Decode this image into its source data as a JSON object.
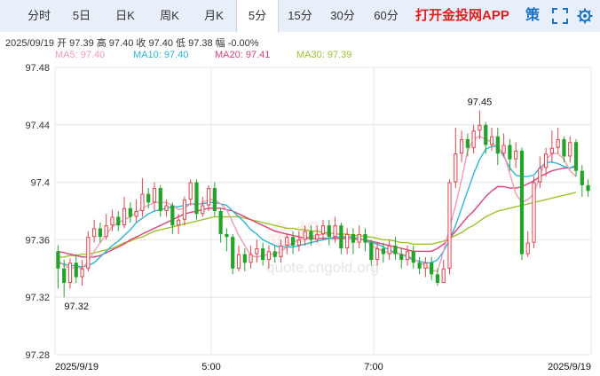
{
  "tabs": [
    {
      "label": "分时",
      "active": false
    },
    {
      "label": "5日",
      "active": false
    },
    {
      "label": "日K",
      "active": false
    },
    {
      "label": "周K",
      "active": false
    },
    {
      "label": "月K",
      "active": false
    },
    {
      "label": "5分",
      "active": true
    },
    {
      "label": "15分",
      "active": false
    },
    {
      "label": "30分",
      "active": false
    },
    {
      "label": "60分",
      "active": false
    }
  ],
  "promo_text": "打开金投网APP",
  "policy_label": "策",
  "ohlc": "2025/09/19  开 97.39  高 97.40  收 97.40  低 97.38  幅 -0.00%",
  "ma": [
    {
      "label": "MA5: 97.40",
      "color": "#f59ab4"
    },
    {
      "label": "MA10: 97.40",
      "color": "#29b6d8"
    },
    {
      "label": "MA20: 97.41",
      "color": "#e0407a"
    },
    {
      "label": "MA30: 97.39",
      "color": "#9cc32a"
    }
  ],
  "watermark": "金投",
  "watermark_url": "quote.cngold.org",
  "chart_data": {
    "type": "candlestick",
    "ylim": [
      97.28,
      97.48
    ],
    "y_ticks": [
      "97.48",
      "97.44",
      "97.4",
      "97.36",
      "97.32",
      "97.28"
    ],
    "x_ticks": [
      "2025/9/19",
      "5:00",
      "7:00",
      "2025/9/19"
    ],
    "annotations": [
      {
        "text": "97.45",
        "value": 97.45
      },
      {
        "text": "97.32",
        "value": 97.32
      }
    ],
    "up_color": "#e0454c",
    "down_color": "#22a32a",
    "candles": [
      [
        97.352,
        97.34,
        97.356,
        97.326
      ],
      [
        97.34,
        97.33,
        97.346,
        97.32
      ],
      [
        97.33,
        97.344,
        97.347,
        97.326
      ],
      [
        97.344,
        97.334,
        97.35,
        97.33
      ],
      [
        97.334,
        97.34,
        97.346,
        97.328
      ],
      [
        97.34,
        97.362,
        97.366,
        97.338
      ],
      [
        97.362,
        97.368,
        97.374,
        97.358
      ],
      [
        97.368,
        97.362,
        97.372,
        97.358
      ],
      [
        97.362,
        97.37,
        97.378,
        97.36
      ],
      [
        97.37,
        97.376,
        97.381,
        97.366
      ],
      [
        97.376,
        97.37,
        97.38,
        97.366
      ],
      [
        97.37,
        97.382,
        97.39,
        97.368
      ],
      [
        97.382,
        97.376,
        97.386,
        97.372
      ],
      [
        97.376,
        97.38,
        97.388,
        97.372
      ],
      [
        97.38,
        97.392,
        97.403,
        97.376
      ],
      [
        97.392,
        97.386,
        97.396,
        97.382
      ],
      [
        97.386,
        97.396,
        97.4,
        97.38
      ],
      [
        97.396,
        97.38,
        97.398,
        97.376
      ],
      [
        97.38,
        97.384,
        97.388,
        97.376
      ],
      [
        97.384,
        97.37,
        97.386,
        97.364
      ],
      [
        97.37,
        97.374,
        97.378,
        97.364
      ],
      [
        97.374,
        97.388,
        97.39,
        97.37
      ],
      [
        97.388,
        97.4,
        97.402,
        97.384
      ],
      [
        97.4,
        97.378,
        97.402,
        97.374
      ],
      [
        97.378,
        97.384,
        97.39,
        97.376
      ],
      [
        97.384,
        97.396,
        97.398,
        97.38
      ],
      [
        97.396,
        97.38,
        97.4,
        97.376
      ],
      [
        97.38,
        97.364,
        97.382,
        97.358
      ],
      [
        97.364,
        97.362,
        97.368,
        97.352
      ],
      [
        97.362,
        97.34,
        97.364,
        97.336
      ],
      [
        97.34,
        97.35,
        97.356,
        97.338
      ],
      [
        97.35,
        97.344,
        97.354,
        97.338
      ],
      [
        97.344,
        97.35,
        97.356,
        97.34
      ],
      [
        97.35,
        97.354,
        97.36,
        97.344
      ],
      [
        97.354,
        97.346,
        97.358,
        97.342
      ],
      [
        97.346,
        97.352,
        97.356,
        97.34
      ],
      [
        97.352,
        97.348,
        97.356,
        97.344
      ],
      [
        97.348,
        97.356,
        97.36,
        97.344
      ],
      [
        97.356,
        97.362,
        97.364,
        97.35
      ],
      [
        97.362,
        97.356,
        97.366,
        97.35
      ],
      [
        97.356,
        97.36,
        97.366,
        97.352
      ],
      [
        97.36,
        97.366,
        97.37,
        97.356
      ],
      [
        97.366,
        97.36,
        97.37,
        97.356
      ],
      [
        97.36,
        97.364,
        97.37,
        97.358
      ],
      [
        97.364,
        97.37,
        97.374,
        97.36
      ],
      [
        97.37,
        97.362,
        97.374,
        97.356
      ],
      [
        97.362,
        97.37,
        97.376,
        97.358
      ],
      [
        97.37,
        97.354,
        97.372,
        97.35
      ],
      [
        97.354,
        97.364,
        97.368,
        97.35
      ],
      [
        97.364,
        97.358,
        97.368,
        97.35
      ],
      [
        97.358,
        97.364,
        97.37,
        97.354
      ],
      [
        97.364,
        97.358,
        97.368,
        97.352
      ],
      [
        97.358,
        97.346,
        97.36,
        97.342
      ],
      [
        97.346,
        97.354,
        97.358,
        97.342
      ],
      [
        97.354,
        97.35,
        97.358,
        97.344
      ],
      [
        97.35,
        97.356,
        97.36,
        97.346
      ],
      [
        97.356,
        97.35,
        97.362,
        97.346
      ],
      [
        97.35,
        97.346,
        97.354,
        97.34
      ],
      [
        97.346,
        97.352,
        97.356,
        97.342
      ],
      [
        97.352,
        97.344,
        97.356,
        97.34
      ],
      [
        97.344,
        97.34,
        97.348,
        97.336
      ],
      [
        97.34,
        97.344,
        97.348,
        97.334
      ],
      [
        97.344,
        97.336,
        97.348,
        97.332
      ],
      [
        97.336,
        97.33,
        97.34,
        97.328
      ],
      [
        97.33,
        97.34,
        97.346,
        97.334
      ],
      [
        97.34,
        97.4,
        97.402,
        97.336
      ],
      [
        97.4,
        97.42,
        97.438,
        97.396
      ],
      [
        97.42,
        97.43,
        97.436,
        97.414
      ],
      [
        97.43,
        97.424,
        97.434,
        97.418
      ],
      [
        97.424,
        97.436,
        97.44,
        97.42
      ],
      [
        97.436,
        97.44,
        97.45,
        97.43
      ],
      [
        97.44,
        97.426,
        97.442,
        97.42
      ],
      [
        97.426,
        97.432,
        97.438,
        97.422
      ],
      [
        97.432,
        97.42,
        97.438,
        97.412
      ],
      [
        97.42,
        97.426,
        97.434,
        97.418
      ],
      [
        97.426,
        97.416,
        97.43,
        97.408
      ],
      [
        97.416,
        97.422,
        97.428,
        97.41
      ],
      [
        97.422,
        97.35,
        97.424,
        97.346
      ],
      [
        97.35,
        97.358,
        97.366,
        97.348
      ],
      [
        97.358,
        97.4,
        97.404,
        97.354
      ],
      [
        97.4,
        97.41,
        97.418,
        97.396
      ],
      [
        97.41,
        97.42,
        97.424,
        97.404
      ],
      [
        97.42,
        97.424,
        97.436,
        97.414
      ],
      [
        97.424,
        97.43,
        97.438,
        97.42
      ],
      [
        97.43,
        97.418,
        97.432,
        97.414
      ],
      [
        97.418,
        97.428,
        97.432,
        97.414
      ],
      [
        97.428,
        97.408,
        97.43,
        97.404
      ],
      [
        97.408,
        97.398,
        97.412,
        97.39
      ],
      [
        97.398,
        97.394,
        97.402,
        97.39
      ]
    ],
    "ma5": [
      97.346,
      97.342,
      97.34,
      97.341,
      97.34,
      97.345,
      97.352,
      97.358,
      97.364,
      97.369,
      97.372,
      97.374,
      97.376,
      97.379,
      97.382,
      97.384,
      97.386,
      97.386,
      97.386,
      97.384,
      97.381,
      97.382,
      97.385,
      97.384,
      97.386,
      97.388,
      97.388,
      97.385,
      97.381,
      97.372,
      97.363,
      97.356,
      97.349,
      97.348,
      97.349,
      97.35,
      97.35,
      97.352,
      97.355,
      97.358,
      97.36,
      97.362,
      97.362,
      97.363,
      97.364,
      97.364,
      97.365,
      97.363,
      97.362,
      97.36,
      97.36,
      97.36,
      97.356,
      97.354,
      97.352,
      97.351,
      97.351,
      97.35,
      97.349,
      97.347,
      97.344,
      97.342,
      97.339,
      97.338,
      97.352,
      97.368,
      97.384,
      97.402,
      97.422,
      97.43,
      97.432,
      97.43,
      97.428,
      97.424,
      97.42,
      97.406,
      97.392,
      97.386,
      97.388,
      97.392,
      97.405,
      97.416,
      97.42,
      97.42,
      97.416,
      97.408,
      97.404
    ],
    "ma10": [
      97.344,
      97.343,
      97.342,
      97.342,
      97.341,
      97.342,
      97.344,
      97.348,
      97.352,
      97.356,
      97.359,
      97.363,
      97.367,
      97.372,
      97.375,
      97.378,
      97.38,
      97.381,
      97.382,
      97.383,
      97.383,
      97.384,
      97.385,
      97.385,
      97.385,
      97.386,
      97.386,
      97.385,
      97.384,
      97.38,
      97.376,
      97.372,
      97.367,
      97.364,
      97.36,
      97.358,
      97.356,
      97.355,
      97.355,
      97.355,
      97.356,
      97.357,
      97.358,
      97.359,
      97.36,
      97.361,
      97.362,
      97.362,
      97.362,
      97.362,
      97.361,
      97.36,
      97.358,
      97.357,
      97.355,
      97.353,
      97.351,
      97.35,
      97.348,
      97.346,
      97.345,
      97.344,
      97.344,
      97.346,
      97.352,
      97.36,
      97.37,
      97.382,
      97.394,
      97.406,
      97.416,
      97.423,
      97.425,
      97.425,
      97.418,
      97.41,
      97.405,
      97.404,
      97.404,
      97.405,
      97.41,
      97.414,
      97.414,
      97.413,
      97.411,
      97.41,
      97.412
    ],
    "ma20": [
      97.352,
      97.351,
      97.35,
      97.349,
      97.348,
      97.348,
      97.348,
      97.349,
      97.351,
      97.353,
      97.355,
      97.357,
      97.36,
      97.362,
      97.364,
      97.366,
      97.368,
      97.37,
      97.372,
      97.374,
      97.376,
      97.378,
      97.379,
      97.38,
      97.381,
      97.382,
      97.382,
      97.382,
      97.381,
      97.38,
      97.378,
      97.376,
      97.374,
      97.372,
      97.37,
      97.368,
      97.366,
      97.365,
      97.364,
      97.363,
      97.362,
      97.361,
      97.361,
      97.361,
      97.361,
      97.361,
      97.361,
      97.361,
      97.361,
      97.361,
      97.36,
      97.36,
      97.359,
      97.358,
      97.357,
      97.356,
      97.355,
      97.354,
      97.353,
      97.352,
      97.352,
      97.352,
      97.352,
      97.354,
      97.357,
      97.361,
      97.366,
      97.371,
      97.376,
      97.38,
      97.385,
      97.39,
      97.394,
      97.397,
      97.397,
      97.396,
      97.396,
      97.397,
      97.399,
      97.401,
      97.404,
      97.406,
      97.408,
      97.409,
      97.41,
      97.41,
      97.411
    ],
    "ma30": [
      97.348,
      97.348,
      97.349,
      97.349,
      97.35,
      97.35,
      97.351,
      97.352,
      97.353,
      97.354,
      97.356,
      97.358,
      97.359,
      97.361,
      97.362,
      97.364,
      97.366,
      97.367,
      97.368,
      97.369,
      97.37,
      97.371,
      97.372,
      97.373,
      97.374,
      97.375,
      97.376,
      97.376,
      97.376,
      97.376,
      97.376,
      97.375,
      97.374,
      97.373,
      97.372,
      97.371,
      97.37,
      97.369,
      97.368,
      97.368,
      97.367,
      97.367,
      97.366,
      97.366,
      97.365,
      97.365,
      97.364,
      97.364,
      97.364,
      97.363,
      97.363,
      97.362,
      97.362,
      97.361,
      97.36,
      97.36,
      97.359,
      97.358,
      97.358,
      97.357,
      97.357,
      97.357,
      97.357,
      97.358,
      97.359,
      97.361,
      97.363,
      97.365,
      97.368,
      97.37,
      97.373,
      97.376,
      97.378,
      97.38,
      97.381,
      97.382,
      97.383,
      97.384,
      97.385,
      97.386,
      97.387,
      97.388,
      97.389,
      97.39,
      97.391,
      97.392,
      97.393
    ]
  }
}
